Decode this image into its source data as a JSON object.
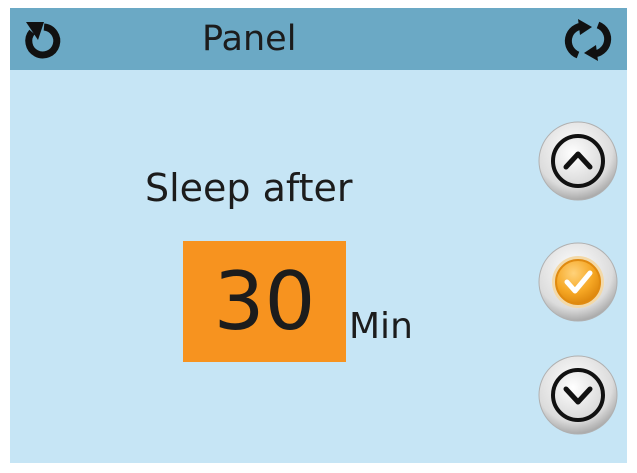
{
  "header": {
    "title": "Panel",
    "back_icon": "back-icon",
    "refresh_icon": "refresh-icon"
  },
  "setting": {
    "label": "Sleep after",
    "value": "30",
    "unit": "Min"
  },
  "controls": {
    "up_icon": "chevron-up-icon",
    "confirm_icon": "checkmark-icon",
    "down_icon": "chevron-down-icon"
  },
  "colors": {
    "background": "#c6e5f5",
    "header": "#6ba9c5",
    "value_box": "#f7931f",
    "confirm_accent": "#f5a623"
  }
}
